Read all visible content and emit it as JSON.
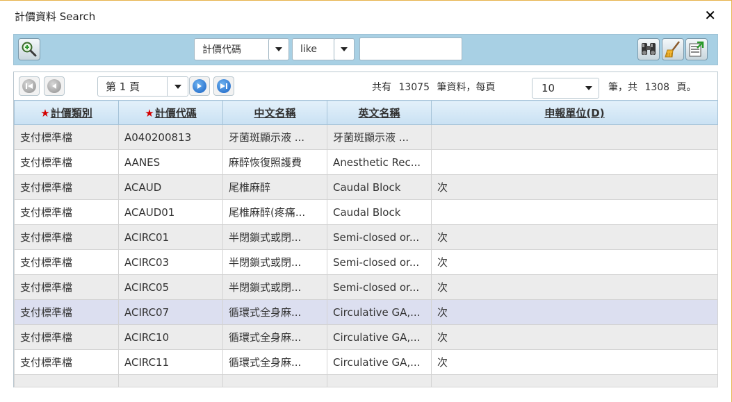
{
  "dialog": {
    "title": "計價資料 Search",
    "close_label": "✕"
  },
  "toolbar": {
    "search_icon": "search-add-icon",
    "field_select": "計價代碼",
    "operator_select": "like",
    "search_value": "",
    "right_icons": [
      "binoculars-icon",
      "broom-icon",
      "export-icon"
    ]
  },
  "pager": {
    "page_label": "第 1 頁",
    "total_prefix": "共有",
    "total_count": "13075",
    "per_page_text": "筆資料，每頁",
    "page_size": "10",
    "pages_prefix": "筆，共",
    "page_count": "1308",
    "pages_suffix": "頁。"
  },
  "grid": {
    "columns": [
      {
        "label": "計價類別",
        "required": true
      },
      {
        "label": "計價代碼",
        "required": true
      },
      {
        "label": "中文名稱",
        "required": false
      },
      {
        "label": "英文名稱",
        "required": false
      },
      {
        "label": "申報單位(D)",
        "required": false
      }
    ],
    "rows": [
      [
        "支付標準檔",
        "A040200813",
        "牙菌斑顯示液 ...",
        "牙菌斑顯示液 ...",
        ""
      ],
      [
        "支付標準檔",
        "AANES",
        "麻醉恢復照護費",
        "Anesthetic Rec...",
        ""
      ],
      [
        "支付標準檔",
        "ACAUD",
        "尾椎麻醉",
        "Caudal Block",
        "次"
      ],
      [
        "支付標準檔",
        "ACAUD01",
        "尾椎麻醉(疼痛...",
        "Caudal Block",
        ""
      ],
      [
        "支付標準檔",
        "ACIRC01",
        "半閉鎖式或閉...",
        "Semi-closed or...",
        "次"
      ],
      [
        "支付標準檔",
        "ACIRC03",
        "半閉鎖式或閉...",
        "Semi-closed or...",
        "次"
      ],
      [
        "支付標準檔",
        "ACIRC05",
        "半閉鎖式或閉...",
        "Semi-closed or...",
        "次"
      ],
      [
        "支付標準檔",
        "ACIRC07",
        "循環式全身麻...",
        "Circulative GA,...",
        "次"
      ],
      [
        "支付標準檔",
        "ACIRC10",
        "循環式全身麻...",
        "Circulative GA,...",
        "次"
      ],
      [
        "支付標準檔",
        "ACIRC11",
        "循環式全身麻...",
        "Circulative GA,...",
        "次"
      ]
    ],
    "selected_row": 7
  }
}
